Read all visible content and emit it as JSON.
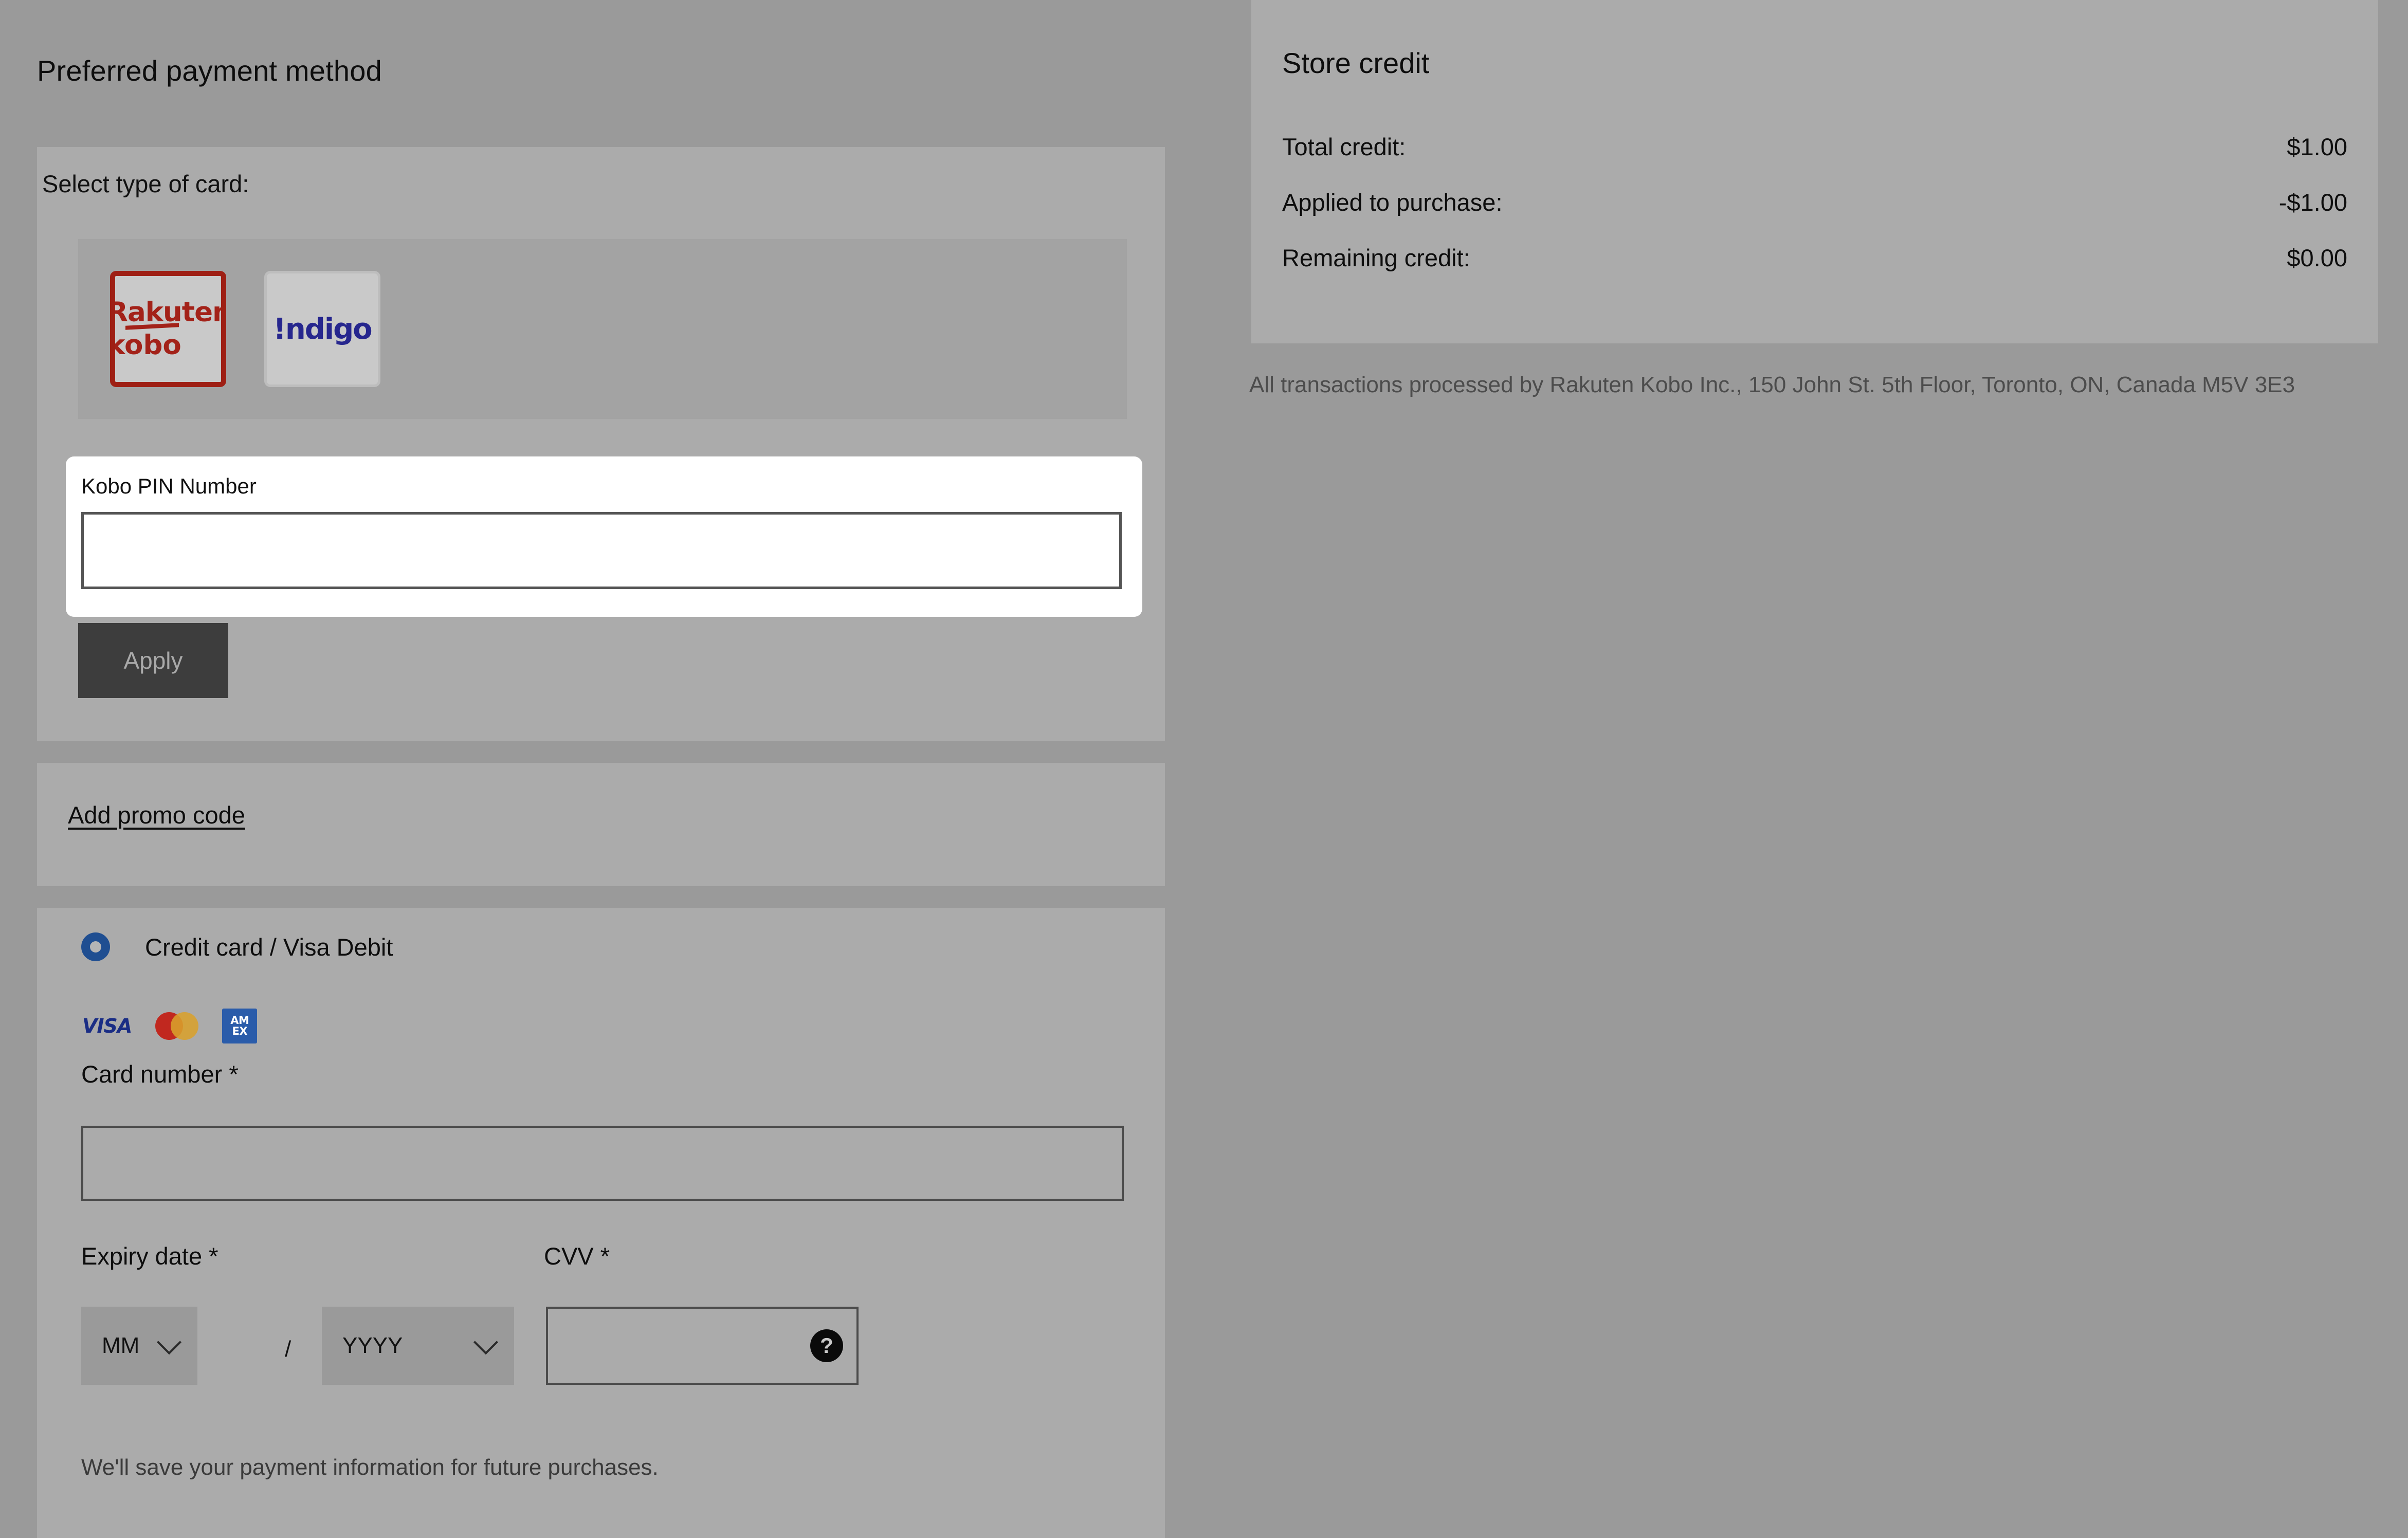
{
  "page": {
    "title": "Preferred payment method"
  },
  "card_type": {
    "label": "Select type of card:",
    "options": [
      {
        "name": "rakuten-kobo",
        "line1": "Rakuten",
        "line2": "kobo",
        "selected": true
      },
      {
        "name": "indigo",
        "line1": "!ndigo",
        "selected": false
      }
    ]
  },
  "pin": {
    "label": "Kobo PIN Number",
    "value": "",
    "placeholder": "",
    "apply_label": "Apply"
  },
  "promo": {
    "link_label": "Add promo code"
  },
  "credit_card": {
    "radio_label": "Credit card / Visa Debit",
    "accepted_brands": [
      "VISA",
      "Mastercard",
      "AMEX"
    ],
    "amex_line1": "AM",
    "amex_line2": "EX",
    "visa_text": "VISA",
    "card_number_label": "Card number *",
    "card_number_value": "",
    "expiry_label": "Expiry date *",
    "expiry_month": "MM",
    "expiry_year": "YYYY",
    "expiry_separator": "/",
    "cvv_label": "CVV *",
    "cvv_value": "",
    "cvv_help_glyph": "?",
    "save_note": "We'll save your payment information for future purchases."
  },
  "store_credit": {
    "title": "Store credit",
    "rows": [
      {
        "label": "Total credit:",
        "value": "$1.00"
      },
      {
        "label": "Applied to purchase:",
        "value": "-$1.00"
      },
      {
        "label": "Remaining credit:",
        "value": "$0.00"
      }
    ]
  },
  "legal": {
    "text": "All transactions processed by Rakuten Kobo Inc., 150 John St. 5th Floor, Toronto, ON, Canada M5V 3E3"
  },
  "colors": {
    "page_bg": "#9a9a9a",
    "panel_bg": "#ababab",
    "kobo_red": "#a32219",
    "indigo_blue": "#26268e",
    "radio_blue": "#1f4e91",
    "apply_bg": "#3d3d3d",
    "visa_blue": "#1a2d85",
    "amex_blue": "#2a5caa",
    "mc_red": "#c1281f",
    "mc_amber": "#d8a12c"
  }
}
